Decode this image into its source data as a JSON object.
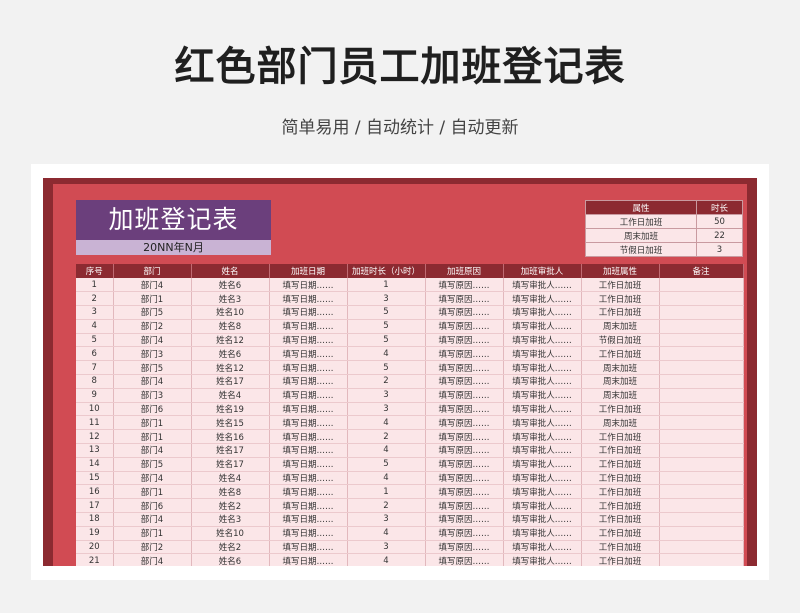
{
  "page": {
    "title": "红色部门员工加班登记表",
    "subtitle": "简单易用 / 自动统计 / 自动更新"
  },
  "sheet": {
    "title": "加班登记表",
    "date": "20NN年N月",
    "summary": {
      "headers": [
        "属性",
        "时长"
      ],
      "rows": [
        [
          "工作日加班",
          "50"
        ],
        [
          "周末加班",
          "22"
        ],
        [
          "节假日加班",
          "3"
        ]
      ]
    },
    "table": {
      "headers": [
        "序号",
        "部门",
        "姓名",
        "加班日期",
        "加班时长（小时）",
        "加班原因",
        "加班审批人",
        "加班属性",
        "备注"
      ],
      "rows": [
        [
          "1",
          "部门4",
          "姓名6",
          "填写日期……",
          "1",
          "填写原因……",
          "填写审批人……",
          "工作日加班",
          ""
        ],
        [
          "2",
          "部门1",
          "姓名3",
          "填写日期……",
          "3",
          "填写原因……",
          "填写审批人……",
          "工作日加班",
          ""
        ],
        [
          "3",
          "部门5",
          "姓名10",
          "填写日期……",
          "5",
          "填写原因……",
          "填写审批人……",
          "工作日加班",
          ""
        ],
        [
          "4",
          "部门2",
          "姓名8",
          "填写日期……",
          "5",
          "填写原因……",
          "填写审批人……",
          "周末加班",
          ""
        ],
        [
          "5",
          "部门4",
          "姓名12",
          "填写日期……",
          "5",
          "填写原因……",
          "填写审批人……",
          "节假日加班",
          ""
        ],
        [
          "6",
          "部门3",
          "姓名6",
          "填写日期……",
          "4",
          "填写原因……",
          "填写审批人……",
          "工作日加班",
          ""
        ],
        [
          "7",
          "部门5",
          "姓名12",
          "填写日期……",
          "5",
          "填写原因……",
          "填写审批人……",
          "周末加班",
          ""
        ],
        [
          "8",
          "部门4",
          "姓名17",
          "填写日期……",
          "2",
          "填写原因……",
          "填写审批人……",
          "周末加班",
          ""
        ],
        [
          "9",
          "部门3",
          "姓名4",
          "填写日期……",
          "3",
          "填写原因……",
          "填写审批人……",
          "周末加班",
          ""
        ],
        [
          "10",
          "部门6",
          "姓名19",
          "填写日期……",
          "3",
          "填写原因……",
          "填写审批人……",
          "工作日加班",
          ""
        ],
        [
          "11",
          "部门1",
          "姓名15",
          "填写日期……",
          "4",
          "填写原因……",
          "填写审批人……",
          "周末加班",
          ""
        ],
        [
          "12",
          "部门1",
          "姓名16",
          "填写日期……",
          "2",
          "填写原因……",
          "填写审批人……",
          "工作日加班",
          ""
        ],
        [
          "13",
          "部门4",
          "姓名17",
          "填写日期……",
          "4",
          "填写原因……",
          "填写审批人……",
          "工作日加班",
          ""
        ],
        [
          "14",
          "部门5",
          "姓名17",
          "填写日期……",
          "5",
          "填写原因……",
          "填写审批人……",
          "工作日加班",
          ""
        ],
        [
          "15",
          "部门4",
          "姓名4",
          "填写日期……",
          "4",
          "填写原因……",
          "填写审批人……",
          "工作日加班",
          ""
        ],
        [
          "16",
          "部门1",
          "姓名8",
          "填写日期……",
          "1",
          "填写原因……",
          "填写审批人……",
          "工作日加班",
          ""
        ],
        [
          "17",
          "部门6",
          "姓名2",
          "填写日期……",
          "2",
          "填写原因……",
          "填写审批人……",
          "工作日加班",
          ""
        ],
        [
          "18",
          "部门4",
          "姓名3",
          "填写日期……",
          "3",
          "填写原因……",
          "填写审批人……",
          "工作日加班",
          ""
        ],
        [
          "19",
          "部门1",
          "姓名10",
          "填写日期……",
          "4",
          "填写原因……",
          "填写审批人……",
          "工作日加班",
          ""
        ],
        [
          "20",
          "部门2",
          "姓名2",
          "填写日期……",
          "3",
          "填写原因……",
          "填写审批人……",
          "工作日加班",
          ""
        ],
        [
          "21",
          "部门4",
          "姓名6",
          "填写日期……",
          "4",
          "填写原因……",
          "填写审批人……",
          "工作日加班",
          ""
        ]
      ]
    }
  }
}
